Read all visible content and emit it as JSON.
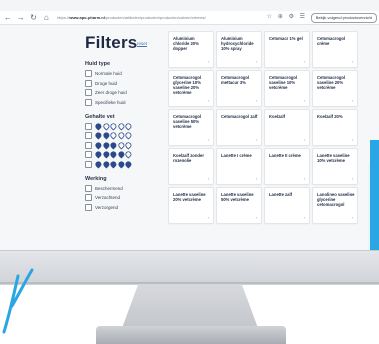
{
  "browser": {
    "url_prefix": "https://",
    "url_domain": "www.apo-pharm.nl",
    "url_rest": "/producten/artikelen/producten/producten/zalven/crèmes/",
    "profile_label": "Bekijk volgend productoverzicht"
  },
  "filters": {
    "title": "Filters",
    "reset_label": "reset",
    "groups": [
      {
        "title": "Huid type",
        "options": [
          "Normale huid",
          "Droge huid",
          "Zeer droge huid",
          "Specifieke huid"
        ]
      },
      {
        "title": "Gehalte vet",
        "levels": [
          1,
          2,
          3,
          4,
          5
        ]
      },
      {
        "title": "Werking",
        "options": [
          "Beschermend",
          "Verzachtend",
          "Verzorgend"
        ]
      }
    ]
  },
  "products": [
    "Aluminium chloride 20% dopper",
    "Aluminium hydroxychloride 10% spray",
    "Cetomacr 1% gel",
    "Cetomacrogol crème",
    "Cetomacrogol glycerine 10% vaseline 20% vetcrème",
    "Cetomacrogol mettacur 3%",
    "Cetomacrogol vaseline 10% vetcrème",
    "Cetomacrogol vaseline 20% vetcrème",
    "Cetomacrogol vaseline 50% vetcrème",
    "Cetomacrogol zalf",
    "Koelzalf",
    "Koelzalf 20%",
    "Koelzalf zonder rozenolie",
    "Lanette I crème",
    "Lanette II crème",
    "Lanette vaseline 10% vetcrème",
    "Lanette vaseline 20% vetcrème",
    "Lanette vaseline 50% vetcrème",
    "Lanette zalf",
    "Lanolineo vaseline glycerine cetomacrogol"
  ],
  "colors": {
    "accent": "#2aa6e4",
    "title": "#1f2a44",
    "drop": "#2c4a8a"
  },
  "icons": [
    "back-icon",
    "forward-icon",
    "reload-icon",
    "home-icon",
    "bookmark-icon",
    "extensions-icon",
    "menu-icon"
  ]
}
